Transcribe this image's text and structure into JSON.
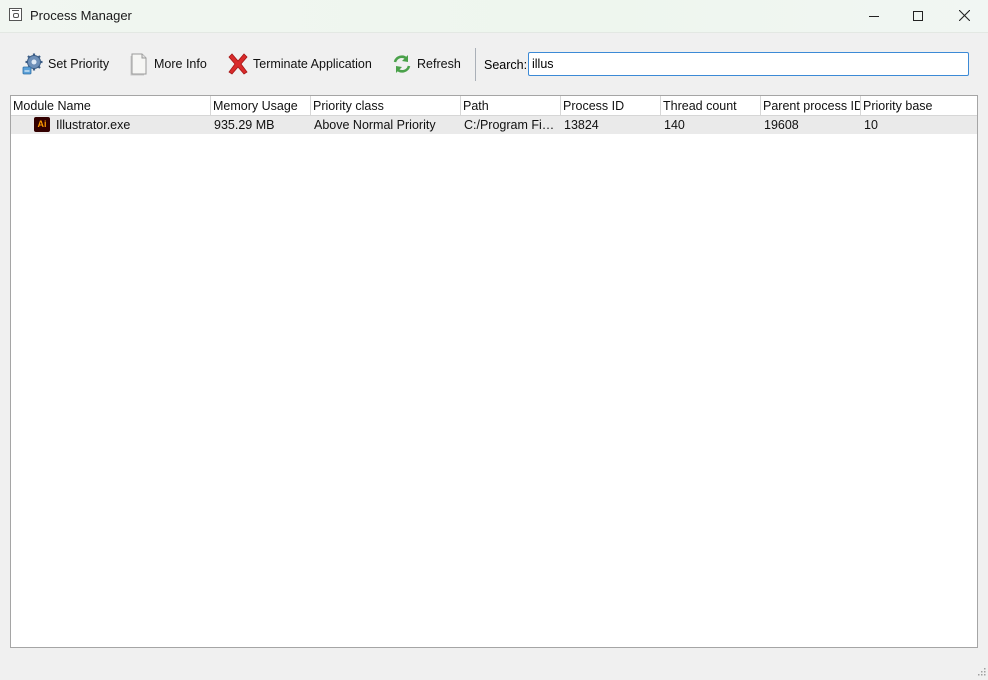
{
  "window": {
    "title": "Process Manager"
  },
  "toolbar": {
    "set_priority_label": "Set Priority",
    "more_info_label": "More Info",
    "terminate_label": "Terminate Application",
    "refresh_label": "Refresh",
    "search_label": "Search:",
    "search_value": "illus"
  },
  "table": {
    "columns": [
      "Module Name",
      "Memory Usage",
      "Priority class",
      "Path",
      "Process ID",
      "Thread count",
      "Parent process ID",
      "Priority base"
    ],
    "rows": [
      {
        "icon": "illustrator-app-icon",
        "icon_text": "Ai",
        "module_name": "Illustrator.exe",
        "memory_usage": "935.29 MB",
        "priority_class": "Above Normal Priority",
        "path": "C:/Program Files/Adobe/Adobe Illustrator/Support Files/Contents/Windows/Illustrator.exe",
        "process_id": "13824",
        "thread_count": "140",
        "parent_process_id": "19608",
        "priority_base": "10"
      }
    ]
  },
  "colors": {
    "accent": "#3c8ad6",
    "terminate_red": "#d92b2b",
    "refresh_green": "#4aa14a"
  }
}
